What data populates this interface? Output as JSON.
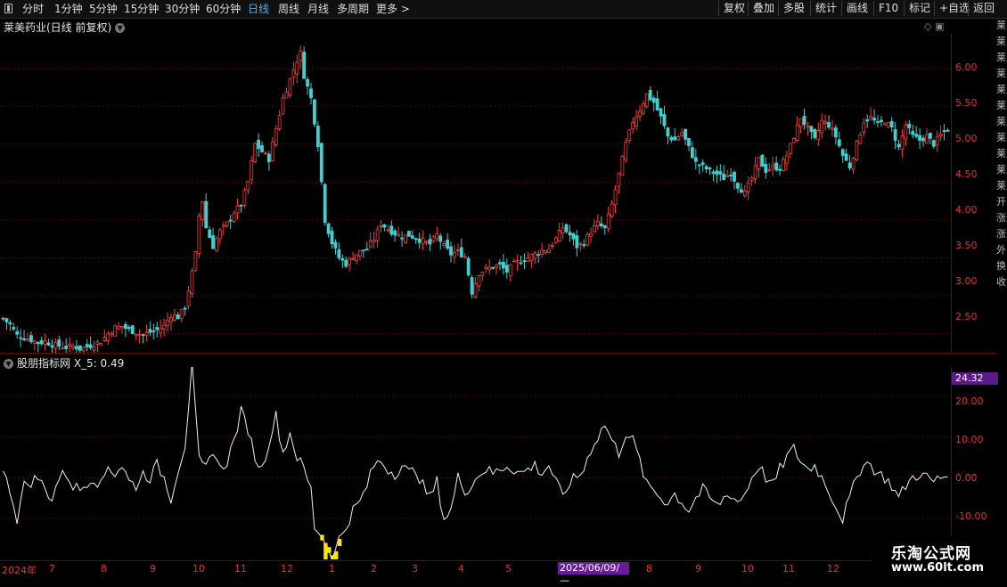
{
  "toolbar": {
    "periods": [
      "分时",
      "1分钟",
      "5分钟",
      "15分钟",
      "30分钟",
      "60分钟",
      "日线",
      "周线",
      "月线",
      "多周期",
      "更多 >"
    ],
    "active_period": "日线",
    "buttons": [
      "复权",
      "叠加",
      "多股",
      "统计",
      "画线",
      "F10",
      "标记",
      "+自选",
      "返回"
    ]
  },
  "main_chart": {
    "title": "莱美药业(日线 前复权)",
    "y_ticks": [
      "6.00",
      "5.50",
      "5.00",
      "4.50",
      "4.00",
      "3.50",
      "3.00",
      "2.50"
    ]
  },
  "indicator": {
    "title": "股朋指标网  X_5: 0.49",
    "current_value": "24.32",
    "y_ticks": [
      "20.00",
      "10.00",
      "0.00",
      "-10.00"
    ]
  },
  "date_axis": {
    "labels": [
      "2024年",
      "7",
      "8",
      "9",
      "10",
      "11",
      "12",
      "1",
      "2",
      "3",
      "4",
      "5",
      "2025/06/09/—",
      "8",
      "9",
      "10",
      "11",
      "12"
    ]
  },
  "right_strip": [
    "莱",
    "莱",
    "莱",
    "莱",
    "莱",
    "莱",
    "莱",
    "莱",
    "莱",
    "莱",
    "莱",
    "开",
    "涨",
    "涨",
    "外",
    "换",
    "收"
  ],
  "watermark": {
    "line1": "乐淘公式网",
    "line2": "www.60lt.com"
  },
  "colors": {
    "up": "#ff3b3b",
    "down": "#3fd0d0",
    "axis": "#e03030",
    "grid": "#5a0000",
    "accent": "#3fb3ff"
  },
  "chart_data": [
    {
      "type": "candlestick",
      "title": "莱美药业(日线 前复权)",
      "ylim": [
        2.25,
        6.45
      ],
      "y_ticks": [
        2.5,
        3.0,
        3.5,
        4.0,
        4.5,
        5.0,
        5.5,
        6.0
      ],
      "x_labels": [
        "2024年",
        "7",
        "8",
        "9",
        "10",
        "11",
        "12",
        "1",
        "2",
        "3",
        "4",
        "5",
        "2025/06/09/—",
        "8",
        "9",
        "10",
        "11",
        "12"
      ],
      "close_path": [
        [
          0,
          2.7
        ],
        [
          2,
          2.62
        ],
        [
          4,
          2.48
        ],
        [
          6,
          2.45
        ],
        [
          8,
          2.42
        ],
        [
          10,
          2.38
        ],
        [
          12,
          2.4
        ],
        [
          14,
          2.36
        ],
        [
          16,
          2.34
        ],
        [
          18,
          2.32
        ],
        [
          20,
          2.34
        ],
        [
          22,
          2.3
        ],
        [
          24,
          2.33
        ],
        [
          26,
          2.36
        ],
        [
          28,
          2.4
        ],
        [
          30,
          2.5
        ],
        [
          32,
          2.58
        ],
        [
          34,
          2.6
        ],
        [
          36,
          2.55
        ],
        [
          38,
          2.52
        ],
        [
          40,
          2.48
        ],
        [
          42,
          2.52
        ],
        [
          44,
          2.55
        ],
        [
          46,
          2.6
        ],
        [
          48,
          2.75
        ],
        [
          50,
          2.72
        ],
        [
          52,
          2.85
        ],
        [
          54,
          3.3
        ],
        [
          55,
          3.55
        ],
        [
          56,
          4.05
        ],
        [
          57,
          4.25
        ],
        [
          58,
          3.9
        ],
        [
          60,
          3.65
        ],
        [
          62,
          3.85
        ],
        [
          64,
          3.95
        ],
        [
          66,
          4.1
        ],
        [
          68,
          4.2
        ],
        [
          70,
          4.5
        ],
        [
          72,
          5.0
        ],
        [
          74,
          4.9
        ],
        [
          76,
          4.8
        ],
        [
          78,
          5.2
        ],
        [
          80,
          5.6
        ],
        [
          82,
          5.85
        ],
        [
          84,
          6.1
        ],
        [
          85,
          6.2
        ],
        [
          86,
          5.9
        ],
        [
          88,
          5.6
        ],
        [
          90,
          5.0
        ],
        [
          91,
          4.5
        ],
        [
          92,
          4.0
        ],
        [
          94,
          3.7
        ],
        [
          96,
          3.5
        ],
        [
          98,
          3.42
        ],
        [
          100,
          3.52
        ],
        [
          102,
          3.58
        ],
        [
          104,
          3.62
        ],
        [
          106,
          3.75
        ],
        [
          108,
          3.95
        ],
        [
          110,
          3.88
        ],
        [
          112,
          3.82
        ],
        [
          114,
          3.78
        ],
        [
          116,
          3.8
        ],
        [
          118,
          3.76
        ],
        [
          120,
          3.72
        ],
        [
          122,
          3.68
        ],
        [
          124,
          3.8
        ],
        [
          126,
          3.65
        ],
        [
          128,
          3.55
        ],
        [
          130,
          3.58
        ],
        [
          132,
          3.52
        ],
        [
          134,
          3.05
        ],
        [
          136,
          3.3
        ],
        [
          138,
          3.35
        ],
        [
          140,
          3.38
        ],
        [
          142,
          3.4
        ],
        [
          144,
          3.32
        ],
        [
          146,
          3.42
        ],
        [
          148,
          3.46
        ],
        [
          150,
          3.5
        ],
        [
          152,
          3.55
        ],
        [
          154,
          3.6
        ],
        [
          156,
          3.62
        ],
        [
          158,
          3.75
        ],
        [
          160,
          3.9
        ],
        [
          162,
          3.8
        ],
        [
          164,
          3.65
        ],
        [
          166,
          3.7
        ],
        [
          168,
          3.85
        ],
        [
          170,
          3.95
        ],
        [
          172,
          3.88
        ],
        [
          174,
          4.2
        ],
        [
          176,
          4.6
        ],
        [
          178,
          5.0
        ],
        [
          180,
          5.3
        ],
        [
          182,
          5.45
        ],
        [
          184,
          5.65
        ],
        [
          186,
          5.55
        ],
        [
          188,
          5.35
        ],
        [
          190,
          5.1
        ],
        [
          192,
          5.05
        ],
        [
          194,
          5.15
        ],
        [
          196,
          4.95
        ],
        [
          198,
          4.75
        ],
        [
          200,
          4.7
        ],
        [
          202,
          4.65
        ],
        [
          204,
          4.6
        ],
        [
          206,
          4.55
        ],
        [
          208,
          4.62
        ],
        [
          210,
          4.45
        ],
        [
          212,
          4.35
        ],
        [
          214,
          4.55
        ],
        [
          216,
          4.8
        ],
        [
          218,
          4.65
        ],
        [
          220,
          4.7
        ],
        [
          222,
          4.68
        ],
        [
          224,
          4.85
        ],
        [
          226,
          5.1
        ],
        [
          228,
          5.35
        ],
        [
          230,
          5.2
        ],
        [
          232,
          5.05
        ],
        [
          234,
          5.3
        ],
        [
          236,
          5.25
        ],
        [
          238,
          5.1
        ],
        [
          240,
          4.85
        ],
        [
          242,
          4.7
        ],
        [
          244,
          5.0
        ],
        [
          246,
          5.3
        ],
        [
          248,
          5.35
        ],
        [
          250,
          5.25
        ],
        [
          252,
          5.3
        ],
        [
          254,
          5.2
        ],
        [
          256,
          4.95
        ],
        [
          258,
          5.25
        ],
        [
          260,
          5.1
        ],
        [
          262,
          5.05
        ],
        [
          264,
          5.1
        ],
        [
          266,
          5.0
        ],
        [
          268,
          5.12
        ],
        [
          270,
          5.2
        ]
      ]
    },
    {
      "type": "line",
      "title": "股朋指标网  X_5: 0.49",
      "series": [
        {
          "name": "X_5",
          "values_path": [
            [
              0,
              1
            ],
            [
              2,
              -3
            ],
            [
              4,
              -10
            ],
            [
              6,
              -2
            ],
            [
              8,
              -1
            ],
            [
              10,
              0
            ],
            [
              12,
              -3
            ],
            [
              14,
              -5
            ],
            [
              16,
              0
            ],
            [
              18,
              1
            ],
            [
              20,
              -2
            ],
            [
              22,
              -3
            ],
            [
              24,
              -1
            ],
            [
              26,
              0
            ],
            [
              28,
              -2
            ],
            [
              30,
              3
            ],
            [
              32,
              1
            ],
            [
              34,
              3
            ],
            [
              36,
              -1
            ],
            [
              38,
              -2
            ],
            [
              40,
              1
            ],
            [
              42,
              0
            ],
            [
              44,
              3
            ],
            [
              46,
              0
            ],
            [
              48,
              -5
            ],
            [
              50,
              2
            ],
            [
              52,
              8
            ],
            [
              54,
              27
            ],
            [
              56,
              4
            ],
            [
              58,
              2
            ],
            [
              60,
              7
            ],
            [
              62,
              2
            ],
            [
              64,
              4
            ],
            [
              66,
              9
            ],
            [
              68,
              16
            ],
            [
              70,
              12
            ],
            [
              72,
              5
            ],
            [
              74,
              2
            ],
            [
              76,
              9
            ],
            [
              78,
              15
            ],
            [
              80,
              6
            ],
            [
              82,
              11
            ],
            [
              84,
              5
            ],
            [
              86,
              2
            ],
            [
              88,
              -3
            ],
            [
              89,
              -12
            ],
            [
              90,
              -13
            ],
            [
              91,
              -14
            ],
            [
              92,
              -16
            ],
            [
              93,
              -17
            ],
            [
              94,
              -19
            ],
            [
              95,
              -18
            ],
            [
              96,
              -15
            ],
            [
              98,
              -12
            ],
            [
              100,
              -8
            ],
            [
              102,
              -6
            ],
            [
              104,
              -2
            ],
            [
              106,
              3
            ],
            [
              108,
              4
            ],
            [
              110,
              2
            ],
            [
              112,
              1
            ],
            [
              114,
              3
            ],
            [
              116,
              1
            ],
            [
              118,
              2
            ],
            [
              120,
              -2
            ],
            [
              122,
              -5
            ],
            [
              124,
              -1
            ],
            [
              126,
              -10
            ],
            [
              128,
              -8
            ],
            [
              130,
              0
            ],
            [
              132,
              -3
            ],
            [
              134,
              -2
            ],
            [
              136,
              1
            ],
            [
              138,
              2
            ],
            [
              140,
              1
            ],
            [
              142,
              2
            ],
            [
              144,
              3
            ],
            [
              146,
              2
            ],
            [
              148,
              1
            ],
            [
              150,
              2
            ],
            [
              152,
              3
            ],
            [
              154,
              1
            ],
            [
              156,
              3
            ],
            [
              158,
              -1
            ],
            [
              160,
              -5
            ],
            [
              162,
              -1
            ],
            [
              164,
              0
            ],
            [
              166,
              2
            ],
            [
              168,
              7
            ],
            [
              170,
              10
            ],
            [
              172,
              13
            ],
            [
              174,
              9
            ],
            [
              176,
              6
            ],
            [
              178,
              11
            ],
            [
              180,
              9
            ],
            [
              182,
              4
            ],
            [
              184,
              -2
            ],
            [
              186,
              -3
            ],
            [
              188,
              -5
            ],
            [
              190,
              -6
            ],
            [
              192,
              -4
            ],
            [
              194,
              -6
            ],
            [
              196,
              -8
            ],
            [
              198,
              -5
            ],
            [
              200,
              -3
            ],
            [
              202,
              -5
            ],
            [
              204,
              -7
            ],
            [
              206,
              -5
            ],
            [
              208,
              -4
            ],
            [
              210,
              -6
            ],
            [
              212,
              -4
            ],
            [
              214,
              0
            ],
            [
              216,
              3
            ],
            [
              218,
              0
            ],
            [
              220,
              -2
            ],
            [
              222,
              2
            ],
            [
              224,
              5
            ],
            [
              226,
              7
            ],
            [
              228,
              4
            ],
            [
              230,
              2
            ],
            [
              232,
              3
            ],
            [
              234,
              0
            ],
            [
              236,
              -3
            ],
            [
              238,
              -7
            ],
            [
              240,
              -10
            ],
            [
              242,
              -5
            ],
            [
              244,
              0
            ],
            [
              246,
              4
            ],
            [
              248,
              3
            ],
            [
              250,
              1
            ],
            [
              252,
              0
            ],
            [
              254,
              -2
            ],
            [
              256,
              -5
            ],
            [
              258,
              -2
            ],
            [
              260,
              0
            ],
            [
              262,
              1
            ],
            [
              264,
              0
            ],
            [
              266,
              -1
            ],
            [
              268,
              0
            ],
            [
              270,
              0.49
            ]
          ]
        }
      ],
      "ylim": [
        -20,
        27
      ],
      "y_ticks": [
        20,
        10,
        0,
        -10
      ],
      "current_value": 24.32
    }
  ]
}
